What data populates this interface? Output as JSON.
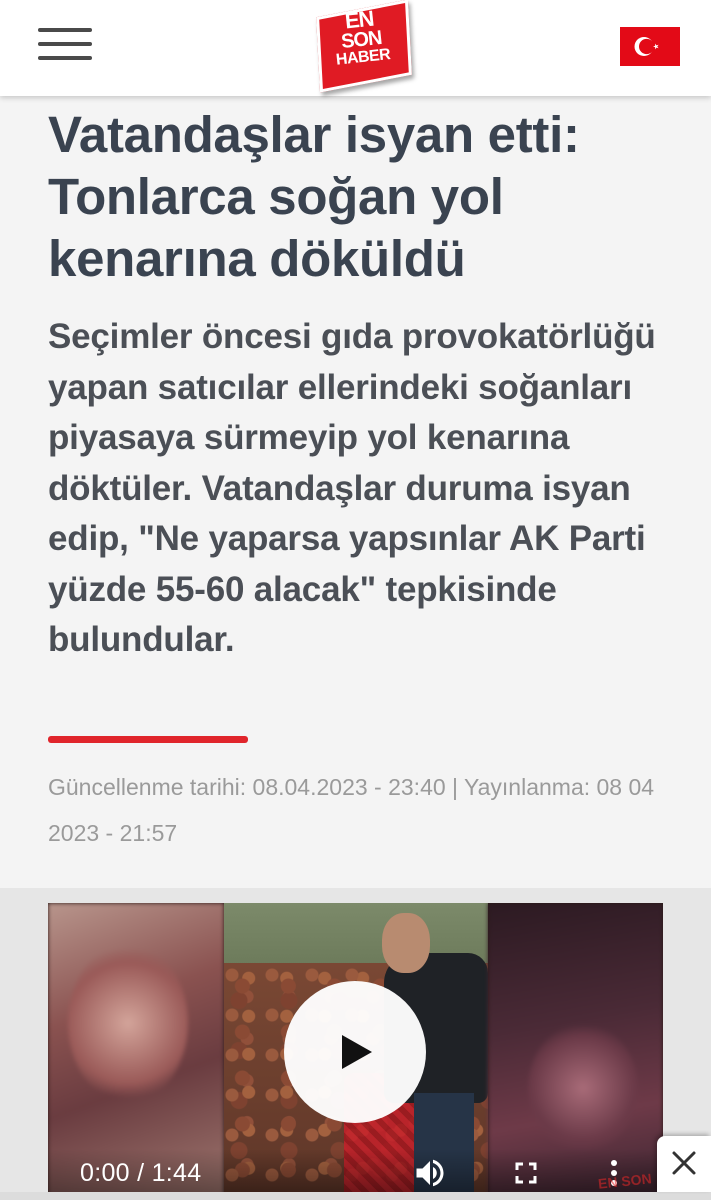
{
  "header": {
    "logo_lines": [
      "EN",
      "SON",
      "HABER"
    ],
    "menu_icon": "hamburger-menu-icon",
    "flag_icon": "turkey-flag-icon"
  },
  "article": {
    "headline": "Vatandaşlar isyan etti: Tonlarca soğan yol kenarına döküldü",
    "summary": "Seçimler öncesi gıda provokatörlüğü yapan satıcılar ellerindeki soğanları piyasaya sürmeyip yol kenarına döktüler. Vatandaşlar duruma isyan edip, \"Ne yaparsa yapsınlar AK Parti yüzde 55-60 alacak\" tepkisinde bulundular.",
    "dates": "Güncellenme tarihi: 08.04.2023 - 23:40 | Yayınlanma: 08 04 2023 - 21:57"
  },
  "video": {
    "time": "0:00 / 1:44",
    "watermark": "EN SON",
    "icons": [
      "play-icon",
      "volume-icon",
      "fullscreen-icon",
      "more-vert-icon"
    ]
  },
  "colors": {
    "brand_red": "#e01b24",
    "headline": "#3a4350",
    "summary": "#4b4f56",
    "dates": "#9a9a9a",
    "accent_bar": "#e0252b"
  },
  "ad": {
    "close_icon": "close-icon"
  }
}
